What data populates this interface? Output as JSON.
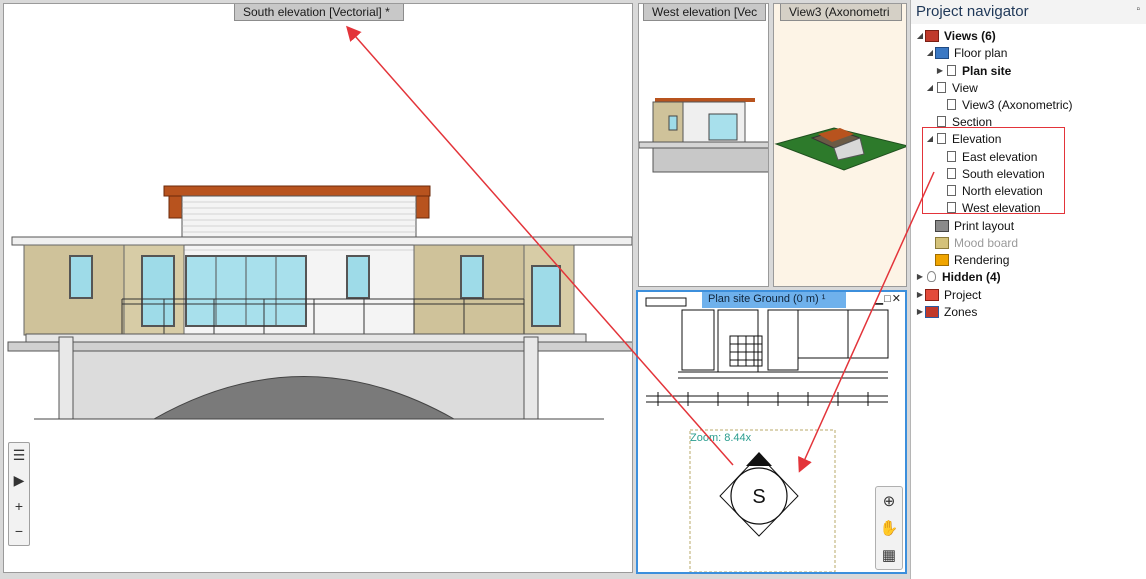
{
  "viewports": {
    "south": {
      "title": "South elevation [Vectorial] *"
    },
    "west": {
      "title": "West elevation [Vec"
    },
    "axo": {
      "title": "View3  (Axonometri"
    },
    "plan": {
      "title": "Plan site Ground (0 m) ¹",
      "zoom": "Zoom: 8.44x",
      "compass_letter": "S"
    }
  },
  "navigator": {
    "title": "Project navigator",
    "items": [
      {
        "label": "Views (6)",
        "icon": "views-icon"
      },
      {
        "label": "Floor plan",
        "icon": "floor-plan-icon"
      },
      {
        "label": "Plan site",
        "icon": "document-icon"
      },
      {
        "label": "View",
        "icon": "document-icon"
      },
      {
        "label": "View3  (Axonometric)",
        "icon": "document-icon"
      },
      {
        "label": "Section",
        "icon": "document-icon"
      },
      {
        "label": "Elevation",
        "icon": "document-icon"
      },
      {
        "label": "East elevation",
        "icon": "document-icon"
      },
      {
        "label": "South elevation",
        "icon": "document-icon"
      },
      {
        "label": "North elevation",
        "icon": "document-icon"
      },
      {
        "label": "West elevation",
        "icon": "document-icon"
      },
      {
        "label": "Print layout",
        "icon": "printer-icon"
      },
      {
        "label": "Mood board",
        "icon": "mood-board-icon"
      },
      {
        "label": "Rendering",
        "icon": "folder-icon"
      },
      {
        "label": "Hidden (4)",
        "icon": "bulb-icon"
      },
      {
        "label": "Project",
        "icon": "project-icon"
      },
      {
        "label": "Zones",
        "icon": "zones-icon"
      }
    ]
  },
  "colors": {
    "annotation": "#e3343a",
    "active_border": "#3c8fdc",
    "roof": "#b8531e"
  }
}
